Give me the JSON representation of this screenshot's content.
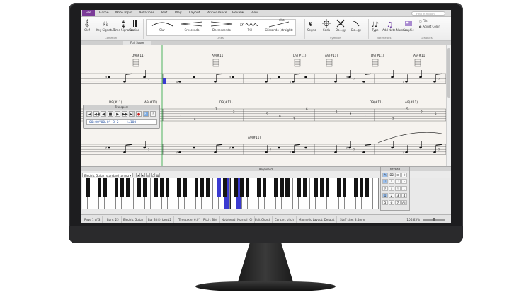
{
  "ribbon": {
    "tabs": [
      "File",
      "Home",
      "Note Input",
      "Notations",
      "Text",
      "Play",
      "Layout",
      "Appearance",
      "Review",
      "View"
    ],
    "search_placeholder": "Find in ribbon",
    "common": {
      "items": [
        "Clef",
        "Key Signature",
        "Time Signature",
        "Barline"
      ],
      "label": "Common"
    },
    "lines": {
      "items": [
        "Slur",
        "Crescendo",
        "Decrescendo",
        "Trill",
        "Glissando (straight)"
      ],
      "label": "Lines",
      "gliss_text": "gliss."
    },
    "symbols": {
      "items": [
        "Segno",
        "Coda",
        "Do...gy",
        "Do...gy"
      ],
      "label": "Symbols"
    },
    "noteheads": {
      "items": [
        "Type",
        "Add Note Names"
      ],
      "label": "Noteheads"
    },
    "graphics": {
      "items": [
        "Graphic",
        "File",
        "Adjust Color"
      ],
      "label": "Graphics"
    }
  },
  "score": {
    "title": "Full Score",
    "chord_symbols": [
      "D9(#11)",
      "A9(#11)",
      "D9(#11)",
      "A9(#11)",
      "D9(#11)",
      "A9(#11)",
      "D9(#11)",
      "A9(#11)",
      "D9(#11)",
      "A9(#11)",
      "D9(#11)",
      "A9(#11)"
    ]
  },
  "transport": {
    "title": "Transport",
    "buttons": [
      "|◀",
      "◀◀",
      "◀",
      "■",
      "▶",
      "▶▶",
      "▶|",
      "●",
      "↻",
      "♪"
    ],
    "time": "00:00\"00.0\"",
    "position": "3",
    "beat": "2",
    "tempo": "♩=100"
  },
  "keyboard": {
    "title": "Keyboard",
    "instrument": "Electric Guitar, standard tuning",
    "highlighted_label": "C4"
  },
  "keypad": {
    "title": "Keypad",
    "rows": [
      [
        "♩",
        "♪",
        "𝅗𝅥",
        "𝅝"
      ],
      [
        "♯",
        "♭",
        "♮",
        "."
      ],
      [
        "1",
        "2",
        "3",
        "4"
      ],
      [
        "5",
        "6",
        "7",
        "All"
      ]
    ]
  },
  "status": {
    "items": [
      "Page 1 of 3",
      "Bars: 25",
      "Electric Guitar",
      "Bar 3 (4), beat 2",
      "Timecode: 6.0\"",
      "Pitch: Bb4",
      "Notehead: Normal (0)",
      "Edit Chord",
      "Concert pitch",
      "Magnetic Layout: Default",
      "Staff size: 3.5mm"
    ],
    "zoom": "106.65%"
  }
}
